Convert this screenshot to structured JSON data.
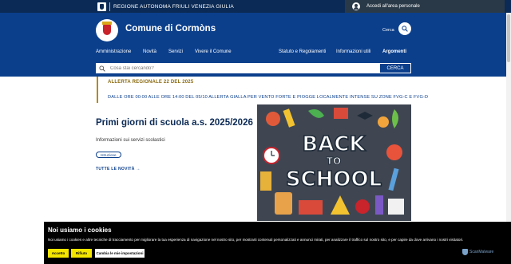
{
  "topbar": {
    "region_name": "REGIONE AUTONOMA FRIULI VENEZIA GIULIA",
    "login_label": "Accedi all'area personale"
  },
  "header": {
    "site_title": "Comune di Cormòns",
    "search_label": "Cerca"
  },
  "nav": {
    "items": [
      "Amministrazione",
      "Novità",
      "Servizi",
      "Vivere il Comune"
    ],
    "secondary": [
      "Statuto e Regolamenti",
      "Informazioni utili",
      "Argomenti"
    ]
  },
  "search": {
    "placeholder": "Cosa stai cercando?",
    "button_label": "CERCA"
  },
  "alert": {
    "title": "ALLERTA REGIONALE 22 DEL 2025",
    "text": "DALLE ORE 00:00 ALLE ORE 14:00 DEL 05/10 ALLERTA GIALLA PER VENTO FORTE E PIOGGE LOCALMENTE INTENSE SU ZONE FVG-C E FVG-D"
  },
  "article": {
    "title": "Primi giorni di scuola a.s. 2025/2026",
    "subtitle": "Informazioni sui servizi scolastici",
    "tag": "Istruzione",
    "all_news": "TUTTE LE NOVITÀ"
  },
  "hero_image": {
    "line1": "BACK",
    "line2": "TO",
    "line3": "SCHOOL"
  },
  "cookie": {
    "title": "Noi usiamo i cookies",
    "text": "Noi usiamo i cookies e altre tecniche di tracciamento per migliorare la tua esperienza di navigazione nel nostro sito, per mostrarti contenuti personalizzati e annunci mirati, per analizzare il traffico sul nostro sito, e per capire da dove arrivano i nostri visitatori.",
    "accept": "Accetto",
    "reject": "Rifiuto",
    "change": "Cambia le mie impostazioni",
    "brand": "ScanMalware"
  }
}
